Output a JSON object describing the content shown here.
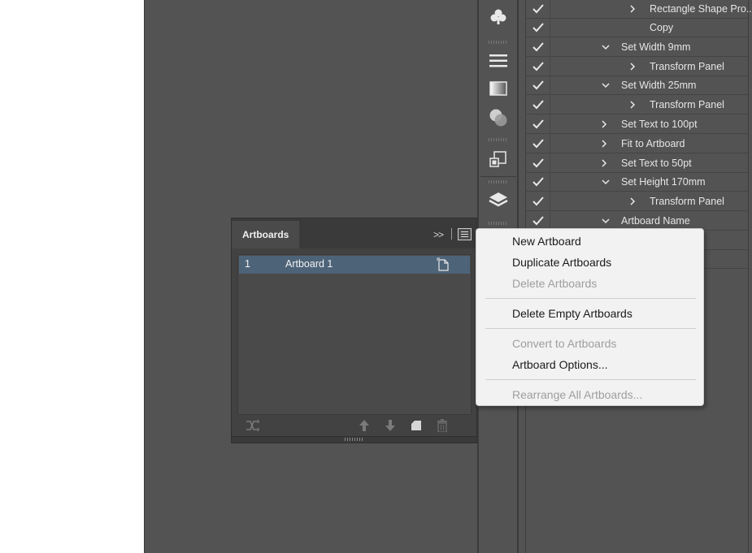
{
  "artboards_panel": {
    "tab_label": "Artboards",
    "collapse_label": ">>",
    "rows": [
      {
        "number": "1",
        "name": "Artboard 1"
      }
    ]
  },
  "context_menu": {
    "items": [
      {
        "label": "New Artboard",
        "enabled": true
      },
      {
        "label": "Duplicate Artboards",
        "enabled": true
      },
      {
        "label": "Delete Artboards",
        "enabled": false
      },
      {
        "label": "Delete Empty Artboards",
        "enabled": true
      },
      {
        "label": "Convert to Artboards",
        "enabled": false
      },
      {
        "label": "Artboard Options...",
        "enabled": true
      },
      {
        "label": "Rearrange All Artboards...",
        "enabled": false
      }
    ]
  },
  "actions": {
    "rows": [
      {
        "label": "Rectangle Shape Pro...",
        "expander": "right"
      },
      {
        "label": "Copy",
        "expander": "none"
      },
      {
        "label": "Set Width 9mm",
        "expander": "down"
      },
      {
        "label": "Transform Panel",
        "expander": "right"
      },
      {
        "label": "Set Width 25mm",
        "expander": "down"
      },
      {
        "label": "Transform Panel",
        "expander": "right"
      },
      {
        "label": "Set Text to 100pt",
        "expander": "right"
      },
      {
        "label": "Fit to Artboard",
        "expander": "right"
      },
      {
        "label": "Set Text to 50pt",
        "expander": "right"
      },
      {
        "label": "Set Height 170mm",
        "expander": "down"
      },
      {
        "label": "Transform Panel",
        "expander": "right"
      },
      {
        "label": "Artboard Name",
        "expander": "down"
      }
    ]
  },
  "icon_strip": {
    "icons": [
      "symbols-icon",
      "stroke-icon",
      "gradient-icon",
      "transparency-icon",
      "transform-icon",
      "layers-icon"
    ]
  },
  "colors": {
    "workspace": "#535353",
    "panel": "#424242",
    "selection": "#4d6378",
    "menu_bg": "#f2f2f2",
    "menu_disabled_text": "#9e9e9e"
  }
}
